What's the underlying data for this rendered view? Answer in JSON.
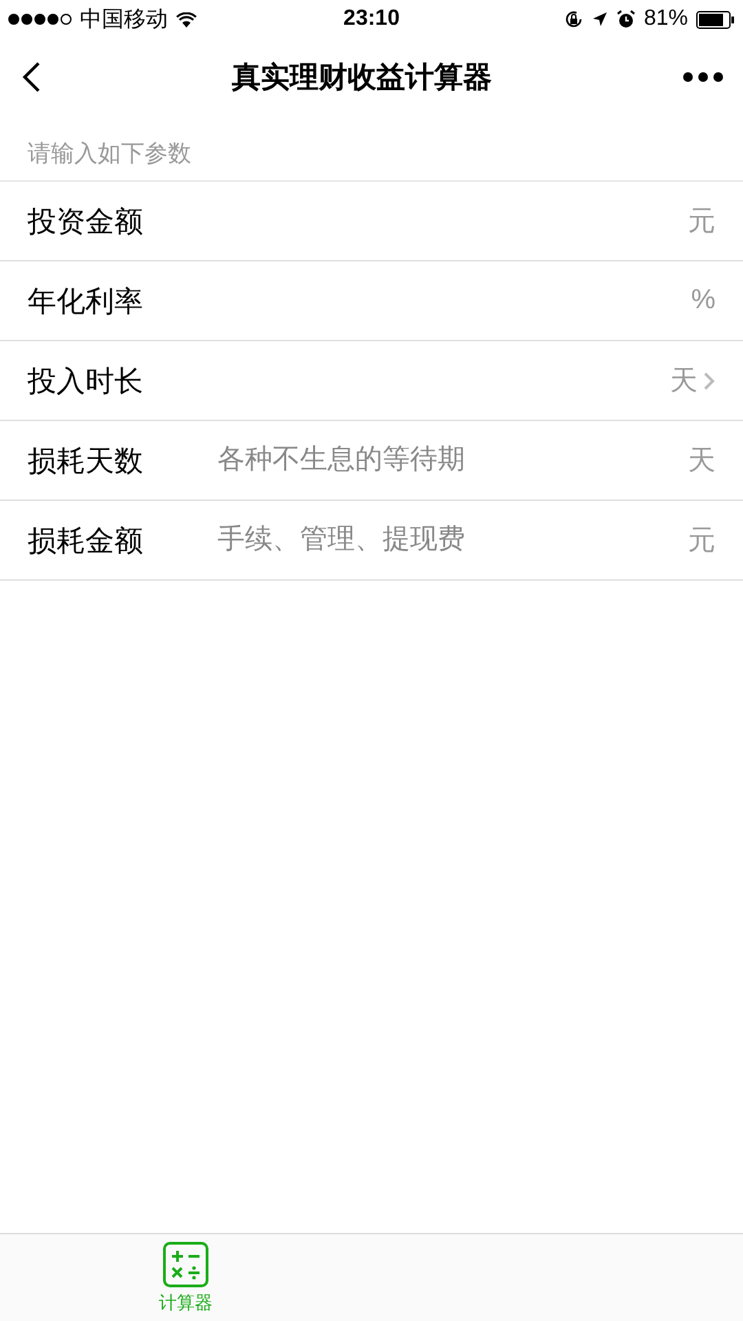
{
  "status_bar": {
    "carrier": "中国移动",
    "time": "23:10",
    "battery": "81%"
  },
  "nav": {
    "title": "真实理财收益计算器"
  },
  "section": {
    "title": "请输入如下参数"
  },
  "fields": [
    {
      "kind": "input",
      "label": "投资金额",
      "unit": "元"
    },
    {
      "kind": "input",
      "label": "年化利率",
      "unit": "%"
    },
    {
      "kind": "picker",
      "label": "投入时长",
      "unit": "天"
    },
    {
      "kind": "input",
      "label": "损耗天数",
      "placeholder": "各种不生息的等待期",
      "unit": "天"
    },
    {
      "kind": "input",
      "label": "损耗金额",
      "placeholder": "手续、管理、提现费",
      "unit": "元"
    }
  ],
  "tab_bar": [
    {
      "label": "计算器",
      "selected": true
    }
  ]
}
